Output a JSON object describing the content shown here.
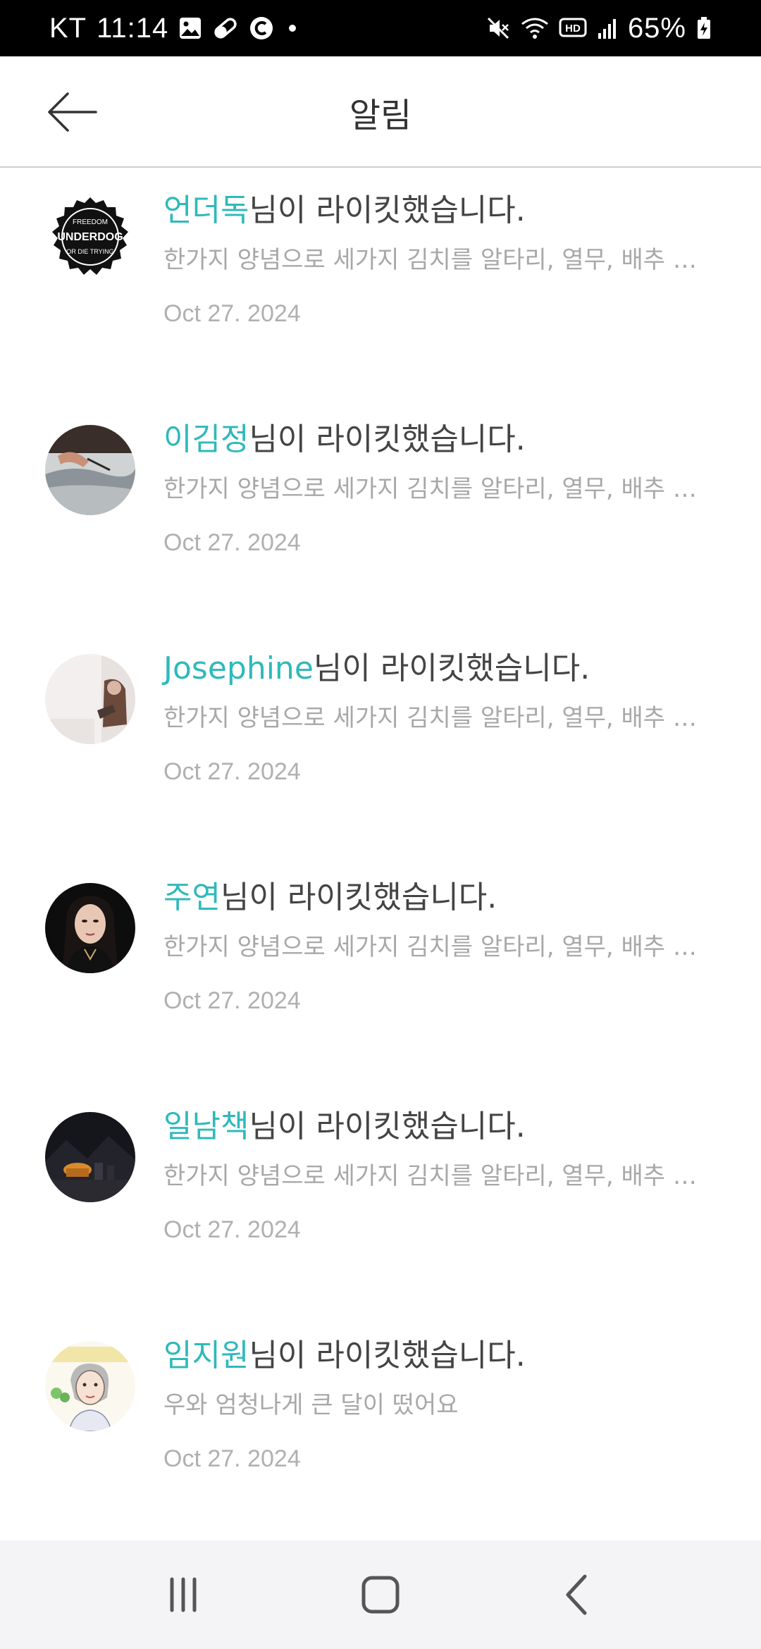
{
  "status_bar": {
    "carrier": "KT",
    "time": "11:14",
    "battery_percent": "65%",
    "hd_label": "HD",
    "left_icons": [
      "gallery-icon",
      "pill-icon",
      "c-badge-icon",
      "dot-icon"
    ],
    "right_icons": [
      "mute-icon",
      "wifi-icon",
      "hd-icon",
      "signal-icon",
      "battery-icon"
    ]
  },
  "header": {
    "title": "알림",
    "back_icon": "arrow-left-icon"
  },
  "colors": {
    "accent": "#2fb9bb",
    "text": "#444444",
    "muted": "#a8a8a8"
  },
  "notifications": [
    {
      "user": "언더독",
      "action": "님이 라이킷했습니다.",
      "snippet": "한가지 양념으로 세가지 김치를 알타리, 열무, 배추 만들기",
      "date": "Oct 27. 2024",
      "avatar_text": [
        "FREEDOM",
        "UNDERDOG",
        "OR DIE TRYING"
      ]
    },
    {
      "user": "이김정",
      "action": "님이 라이킷했습니다.",
      "snippet": "한가지 양념으로 세가지 김치를 알타리, 열무, 배추 만들기",
      "date": "Oct 27. 2024"
    },
    {
      "user": "Josephine",
      "action": "님이 라이킷했습니다.",
      "snippet": "한가지 양념으로 세가지 김치를 알타리, 열무, 배추 만들기",
      "date": "Oct 27. 2024"
    },
    {
      "user": "주연",
      "action": "님이 라이킷했습니다.",
      "snippet": "한가지 양념으로 세가지 김치를 알타리, 열무, 배추 만들기",
      "date": "Oct 27. 2024"
    },
    {
      "user": "일남책",
      "action": "님이 라이킷했습니다.",
      "snippet": "한가지 양념으로 세가지 김치를 알타리, 열무, 배추 만들기",
      "date": "Oct 27. 2024"
    },
    {
      "user": "임지원",
      "action": "님이 라이킷했습니다.",
      "snippet": "우와 엄청나게 큰 달이 떴어요",
      "date": "Oct 27. 2024"
    }
  ],
  "nav_bar": {
    "icons": [
      "recent-apps-icon",
      "home-icon",
      "back-icon"
    ]
  }
}
